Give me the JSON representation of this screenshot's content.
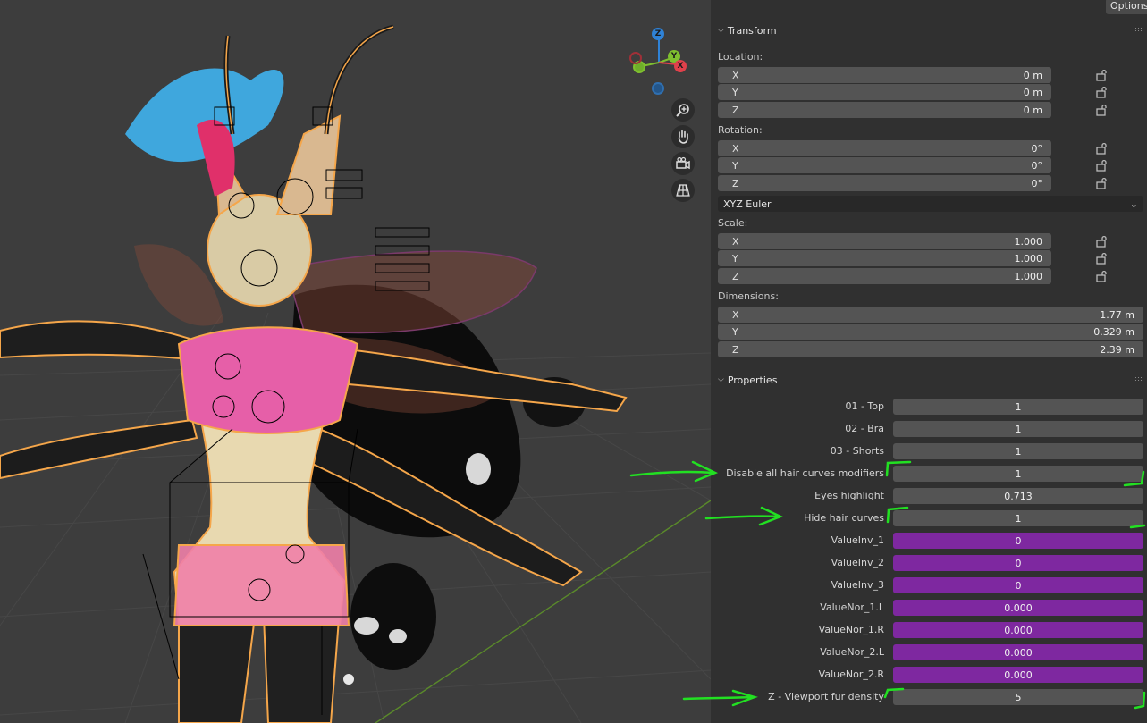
{
  "header": {
    "options_label": "Options"
  },
  "viewport": {
    "gizmo_axes": {
      "z": "Z",
      "y": "Y",
      "x": "X"
    },
    "nav_icons": [
      "zoom-in-icon",
      "hand-pan-icon",
      "camera-icon",
      "grid-perspective-icon"
    ],
    "colors": {
      "background": "#3d3d3d",
      "selection_outline": "#f5a64a",
      "x_axis": "#e0414b",
      "y_axis": "#7fbf2f",
      "z_axis": "#2f82d6"
    }
  },
  "transform": {
    "title": "Transform",
    "location_label": "Location:",
    "location": [
      {
        "axis": "X",
        "value": "0 m"
      },
      {
        "axis": "Y",
        "value": "0 m"
      },
      {
        "axis": "Z",
        "value": "0 m"
      }
    ],
    "rotation_label": "Rotation:",
    "rotation": [
      {
        "axis": "X",
        "value": "0°"
      },
      {
        "axis": "Y",
        "value": "0°"
      },
      {
        "axis": "Z",
        "value": "0°"
      }
    ],
    "rotation_mode": "XYZ Euler",
    "scale_label": "Scale:",
    "scale": [
      {
        "axis": "X",
        "value": "1.000"
      },
      {
        "axis": "Y",
        "value": "1.000"
      },
      {
        "axis": "Z",
        "value": "1.000"
      }
    ],
    "dimensions_label": "Dimensions:",
    "dimensions": [
      {
        "axis": "X",
        "value": "1.77 m"
      },
      {
        "axis": "Y",
        "value": "0.329 m"
      },
      {
        "axis": "Z",
        "value": "2.39 m"
      }
    ]
  },
  "properties": {
    "title": "Properties",
    "items": [
      {
        "label": "01 - Top",
        "value": "1",
        "style": "gray"
      },
      {
        "label": "02 - Bra",
        "value": "1",
        "style": "gray"
      },
      {
        "label": "03 - Shorts",
        "value": "1",
        "style": "gray"
      },
      {
        "label": "Disable all hair curves modifiers",
        "value": "1",
        "style": "gray"
      },
      {
        "label": "Eyes highlight",
        "value": "0.713",
        "style": "gray"
      },
      {
        "label": "Hide hair curves",
        "value": "1",
        "style": "gray"
      },
      {
        "label": "ValueInv_1",
        "value": "0",
        "style": "purple"
      },
      {
        "label": "ValueInv_2",
        "value": "0",
        "style": "purple"
      },
      {
        "label": "ValueInv_3",
        "value": "0",
        "style": "purple"
      },
      {
        "label": "ValueNor_1.L",
        "value": "0.000",
        "style": "purple"
      },
      {
        "label": "ValueNor_1.R",
        "value": "0.000",
        "style": "purple"
      },
      {
        "label": "ValueNor_2.L",
        "value": "0.000",
        "style": "purple"
      },
      {
        "label": "ValueNor_2.R",
        "value": "0.000",
        "style": "purple"
      },
      {
        "label": "Z - Viewport fur density",
        "value": "5",
        "style": "gray"
      }
    ],
    "colors": {
      "purple_field": "#7e28a0",
      "annotation": "#22e022"
    }
  }
}
